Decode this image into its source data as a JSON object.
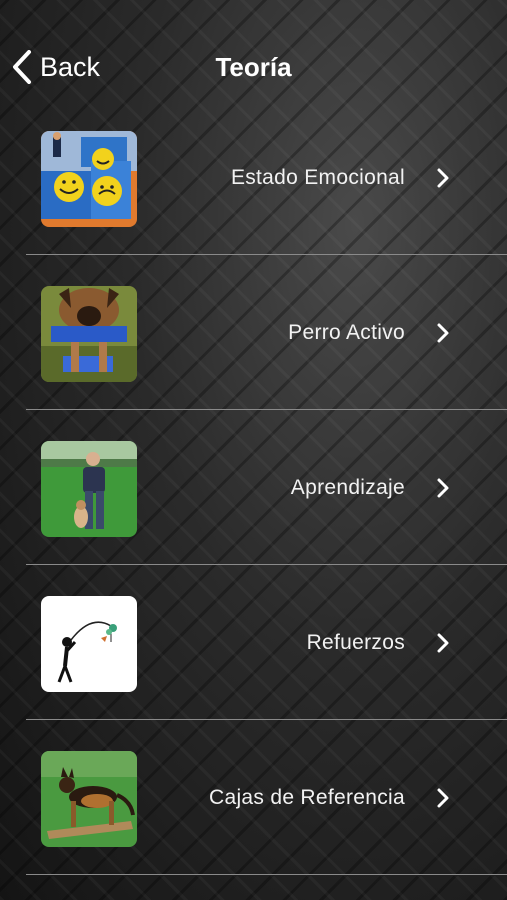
{
  "navbar": {
    "back_label": "Back",
    "title": "Teoría"
  },
  "list": {
    "items": [
      {
        "label": "Estado Emocional",
        "thumbnail": "smiley-blocks-image"
      },
      {
        "label": "Perro Activo",
        "thumbnail": "dog-closeup-image"
      },
      {
        "label": "Aprendizaje",
        "thumbnail": "man-with-dog-image"
      },
      {
        "label": "Refuerzos",
        "thumbnail": "stick-figure-fishing-image"
      },
      {
        "label": "Cajas de Referencia",
        "thumbnail": "german-shepherd-on-box-image"
      }
    ]
  },
  "icons": {
    "back": "chevron-left-icon",
    "disclosure": "chevron-right-icon"
  },
  "colors": {
    "text": "#ffffff",
    "divider": "#8a8a8a"
  }
}
